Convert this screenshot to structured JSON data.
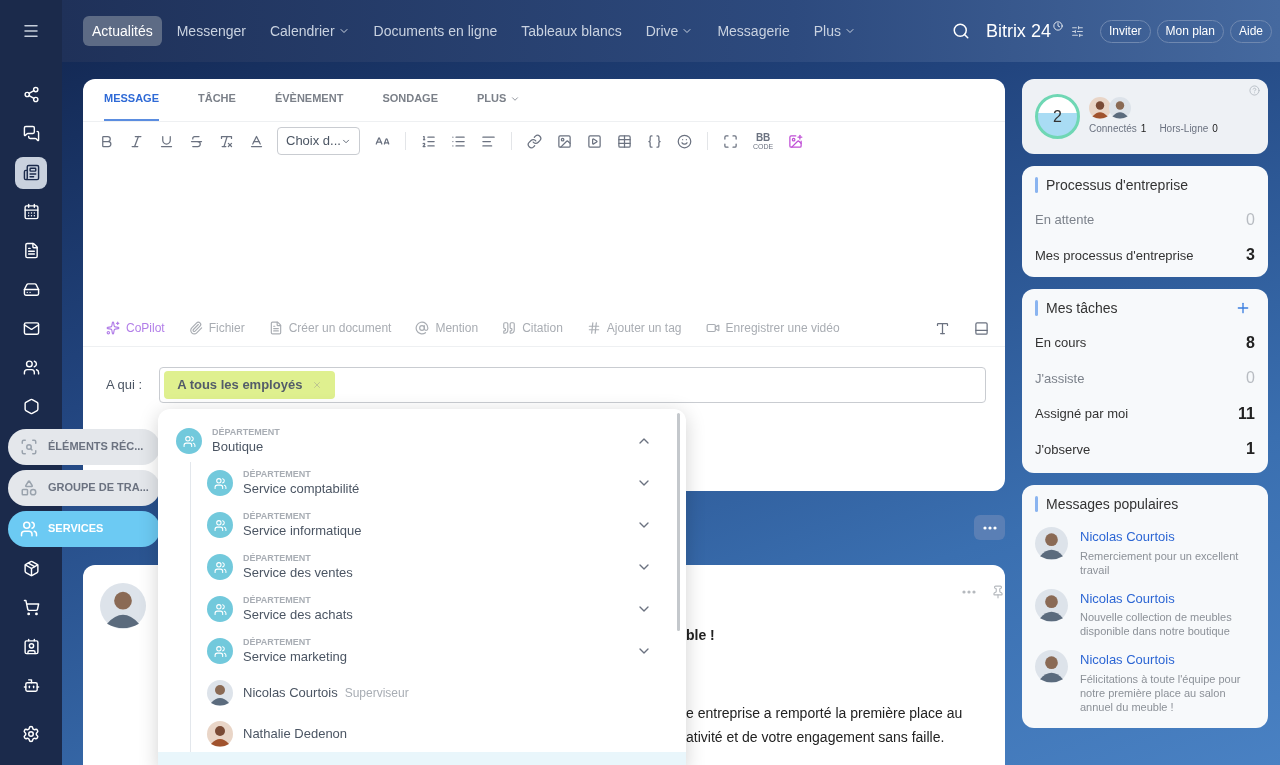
{
  "sidebar": {
    "items": [
      {
        "kind": "icon",
        "selected": false
      },
      {
        "kind": "icon",
        "selected": false
      },
      {
        "kind": "icon",
        "selected": true
      },
      {
        "kind": "icon",
        "selected": false
      },
      {
        "kind": "icon",
        "selected": false
      },
      {
        "kind": "icon",
        "selected": false
      },
      {
        "kind": "icon",
        "selected": false
      },
      {
        "kind": "icon",
        "selected": false
      },
      {
        "kind": "icon",
        "selected": false
      },
      {
        "kind": "pill",
        "label": "ÉLÉMENTS RÉC...",
        "selected": false
      },
      {
        "kind": "pill",
        "label": "GROUPE DE TRA...",
        "selected": false
      },
      {
        "kind": "pill",
        "label": "SERVICES",
        "selected": true
      },
      {
        "kind": "icon",
        "selected": false
      },
      {
        "kind": "icon",
        "selected": false
      },
      {
        "kind": "icon",
        "selected": false
      },
      {
        "kind": "icon",
        "selected": false
      }
    ]
  },
  "topbar": {
    "nav": [
      {
        "label": "Actualités",
        "selected": true,
        "dropdown": false
      },
      {
        "label": "Messenger",
        "selected": false,
        "dropdown": false
      },
      {
        "label": "Calendrier",
        "selected": false,
        "dropdown": true
      },
      {
        "label": "Documents en ligne",
        "selected": false,
        "dropdown": false
      },
      {
        "label": "Tableaux blancs",
        "selected": false,
        "dropdown": false
      },
      {
        "label": "Drive",
        "selected": false,
        "dropdown": true
      },
      {
        "label": "Messagerie",
        "selected": false,
        "dropdown": false
      },
      {
        "label": "Plus",
        "selected": false,
        "dropdown": true
      }
    ],
    "logo": "Bitrix 24",
    "buttons": [
      "Inviter",
      "Mon plan",
      "Aide"
    ]
  },
  "composer": {
    "tabs": [
      {
        "label": "MESSAGE",
        "selected": true,
        "dropdown": false
      },
      {
        "label": "TÂCHE",
        "selected": false,
        "dropdown": false
      },
      {
        "label": "ÉVÈNEMENT",
        "selected": false,
        "dropdown": false
      },
      {
        "label": "SONDAGE",
        "selected": false,
        "dropdown": false
      },
      {
        "label": "PLUS",
        "selected": false,
        "dropdown": true
      }
    ],
    "font_select": "Choix d...",
    "bb": "BB",
    "bb_sub": "CODE",
    "actions": [
      {
        "label": "CoPilot",
        "kind": "copilot"
      },
      {
        "label": "Fichier",
        "kind": "plain"
      },
      {
        "label": "Créer un document",
        "kind": "plain"
      },
      {
        "label": "Mention",
        "kind": "plain"
      },
      {
        "label": "Citation",
        "kind": "plain"
      },
      {
        "label": "Ajouter un tag",
        "kind": "plain"
      },
      {
        "label": "Enregistrer une vidéo",
        "kind": "plain"
      }
    ],
    "recipients_label": "A qui :",
    "recipient_chip": "A tous les employés"
  },
  "selector": {
    "items": [
      {
        "kind": "department",
        "caption": "DÉPARTEMENT",
        "name": "Boutique",
        "expanded": true,
        "children": [
          {
            "kind": "department",
            "caption": "DÉPARTEMENT",
            "name": "Service comptabilité",
            "expanded": false
          },
          {
            "kind": "department",
            "caption": "DÉPARTEMENT",
            "name": "Service informatique",
            "expanded": false
          },
          {
            "kind": "department",
            "caption": "DÉPARTEMENT",
            "name": "Service des ventes",
            "expanded": false
          },
          {
            "kind": "department",
            "caption": "DÉPARTEMENT",
            "name": "Service des achats",
            "expanded": false
          },
          {
            "kind": "department",
            "caption": "DÉPARTEMENT",
            "name": "Service marketing",
            "expanded": false
          },
          {
            "kind": "person",
            "name": "Nicolas Courtois",
            "role": "Superviseur"
          },
          {
            "kind": "person",
            "name": "Nathalie Dedenon"
          }
        ]
      }
    ]
  },
  "post": {
    "title": "ble !",
    "lines": [
      "e entreprise a remporté la première place au",
      "ativité et de votre engagement sans faille."
    ]
  },
  "online": {
    "count": "2",
    "connected_label": "Connectés",
    "connected": "1",
    "offline_label": "Hors-Ligne",
    "offline": "0"
  },
  "processes": {
    "title": "Processus d'entreprise",
    "rows": [
      {
        "label": "En attente",
        "count": "0",
        "muted": true
      },
      {
        "label": "Mes processus d'entreprise",
        "count": "3",
        "muted": false
      }
    ]
  },
  "tasks": {
    "title": "Mes tâches",
    "rows": [
      {
        "label": "En cours",
        "count": "8",
        "muted": false
      },
      {
        "label": "J'assiste",
        "count": "0",
        "muted": true
      },
      {
        "label": "Assigné par moi",
        "count": "11",
        "muted": false
      },
      {
        "label": "J'observe",
        "count": "1",
        "muted": false
      }
    ]
  },
  "popular": {
    "title": "Messages populaires",
    "items": [
      {
        "author": "Nicolas Courtois",
        "text": "Remerciement pour un excellent travail"
      },
      {
        "author": "Nicolas Courtois",
        "text": "Nouvelle collection de meubles disponible dans notre boutique"
      },
      {
        "author": "Nicolas Courtois",
        "text": "Félicitations à toute l'équipe pour notre première place au salon annuel du meuble !"
      }
    ]
  }
}
